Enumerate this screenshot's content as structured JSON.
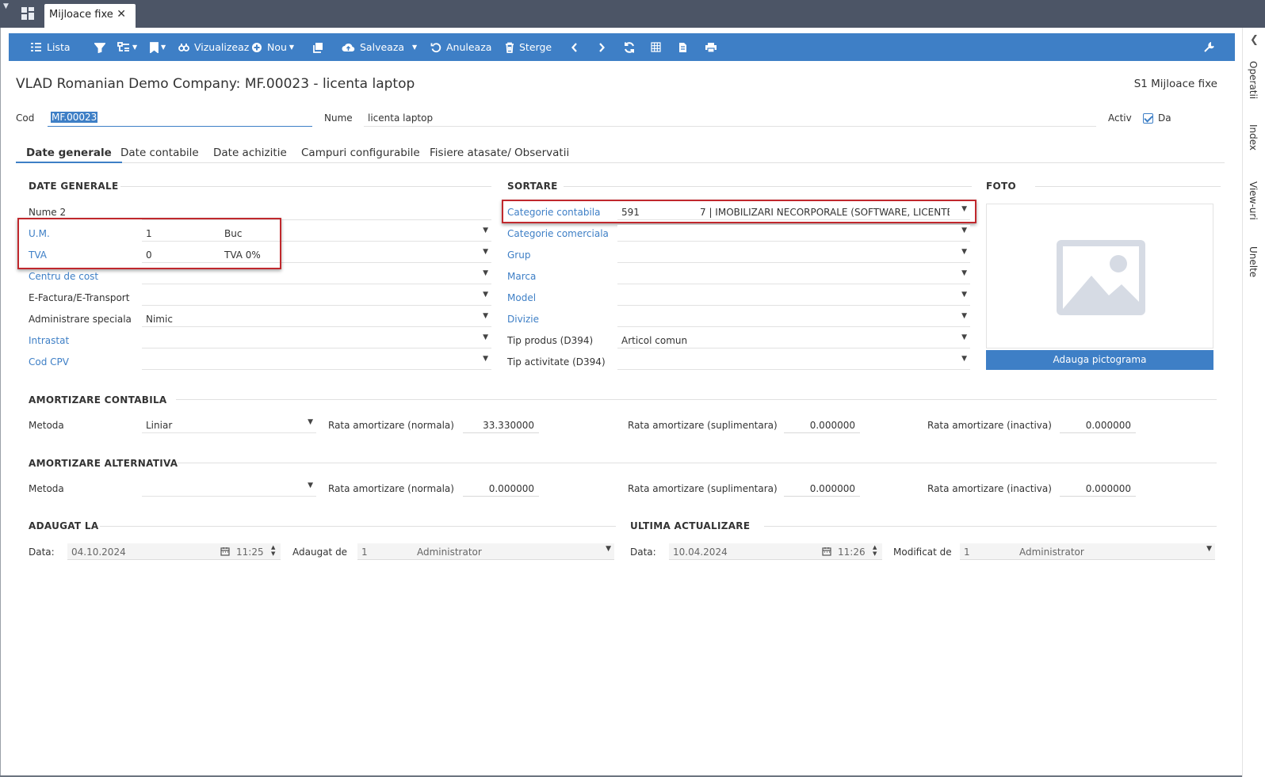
{
  "tab": {
    "title": "Mijloace fixe"
  },
  "toolbar": {
    "lista": "Lista",
    "vizualizeaza": "Vizualizeaz",
    "nou": "Nou",
    "salveaza": "Salveaza",
    "anuleaza": "Anuleaza",
    "sterge": "Sterge"
  },
  "header": {
    "title": "VLAD Romanian Demo Company: MF.00023 - licenta laptop",
    "module": "S1 Mijloace fixe"
  },
  "side_panel": [
    "Operatii",
    "Index",
    "View-uri",
    "Unelte"
  ],
  "top_fields": {
    "cod_label": "Cod",
    "cod_value": "MF.00023",
    "nume_label": "Nume",
    "nume_value": "licenta laptop",
    "activ_label": "Activ",
    "activ_value": "Da"
  },
  "tabs": [
    "Date generale",
    "Date contabile",
    "Date achizitie",
    "Campuri configurabile",
    "Fisiere atasate/ Observatii"
  ],
  "date_generale": {
    "title": "DATE GENERALE",
    "nume2_label": "Nume 2",
    "nume2_value": "",
    "um_label": "U.M.",
    "um_code": "1",
    "um_name": "Buc",
    "tva_label": "TVA",
    "tva_code": "0",
    "tva_name": "TVA 0%",
    "centru_label": "Centru de cost",
    "centru_value": "",
    "efactura_label": "E-Factura/E-Transport",
    "efactura_value": "",
    "admin_label": "Administrare speciala",
    "admin_value": "Nimic",
    "intrastat_label": "Intrastat",
    "intrastat_value": "",
    "cpv_label": "Cod CPV",
    "cpv_value": ""
  },
  "sortare": {
    "title": "SORTARE",
    "categorie_contabila_label": "Categorie contabila",
    "categorie_contabila_code": "591",
    "categorie_contabila_name": "7 | IMOBILIZARI NECORPORALE (SOFTWARE, LICENTE",
    "categorie_comerciala_label": "Categorie comerciala",
    "grup_label": "Grup",
    "marca_label": "Marca",
    "model_label": "Model",
    "divizie_label": "Divizie",
    "tip_produs_label": "Tip produs (D394)",
    "tip_produs_value": "Articol comun",
    "tip_activitate_label": "Tip activitate (D394)"
  },
  "foto": {
    "title": "FOTO",
    "add_button": "Adauga pictograma"
  },
  "amortizare_contabila": {
    "title": "AMORTIZARE CONTABILA",
    "metoda_label": "Metoda",
    "metoda_value": "Liniar",
    "rata_normala_label": "Rata amortizare (normala)",
    "rata_normala_value": "33.330000",
    "rata_suplimentara_label": "Rata amortizare (suplimentara)",
    "rata_suplimentara_value": "0.000000",
    "rata_inactiva_label": "Rata amortizare (inactiva)",
    "rata_inactiva_value": "0.000000"
  },
  "amortizare_alternativa": {
    "title": "AMORTIZARE ALTERNATIVA",
    "metoda_label": "Metoda",
    "metoda_value": "",
    "rata_normala_label": "Rata amortizare (normala)",
    "rata_normala_value": "0.000000",
    "rata_suplimentara_label": "Rata amortizare (suplimentara)",
    "rata_suplimentara_value": "0.000000",
    "rata_inactiva_label": "Rata amortizare (inactiva)",
    "rata_inactiva_value": "0.000000"
  },
  "adaugat": {
    "title": "ADAUGAT LA",
    "data_label": "Data:",
    "date": "04.10.2024",
    "time": "11:25",
    "by_label": "Adaugat de",
    "user_code": "1",
    "user_name": "Administrator"
  },
  "actualizare": {
    "title": "ULTIMA ACTUALIZARE",
    "data_label": "Data:",
    "date": "10.04.2024",
    "time": "11:26",
    "by_label": "Modificat de",
    "user_code": "1",
    "user_name": "Administrator"
  }
}
